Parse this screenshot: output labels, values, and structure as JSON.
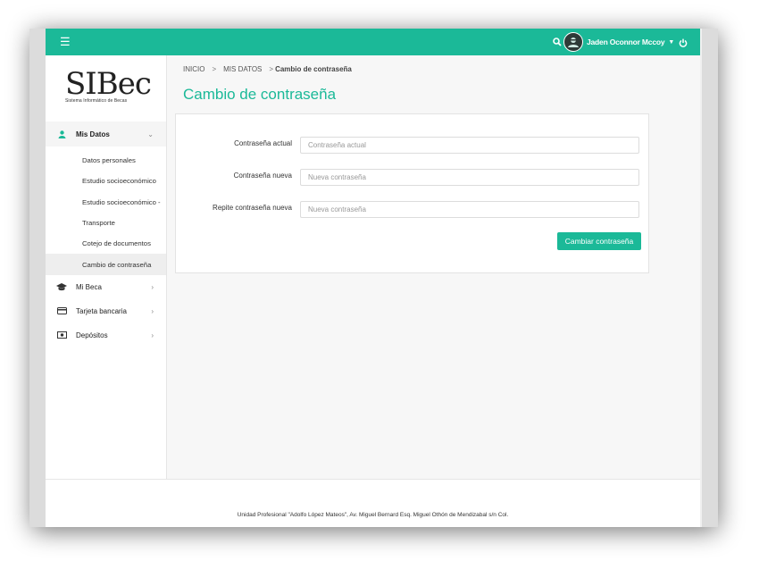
{
  "topbar": {
    "menu_icon": "hamburger-icon",
    "search_icon": "search-icon",
    "user_name": "Jaden Oconnor Mccoy",
    "caret_icon": "chevron-down-icon",
    "power_icon": "power-icon",
    "accent_color": "#1bb998"
  },
  "logo": {
    "text": "SIBec",
    "subtitle": "Sistema Informático de Becas"
  },
  "sidebar": {
    "groups": [
      {
        "label": "Mis Datos",
        "icon": "user-icon",
        "expanded": true,
        "items": [
          {
            "label": "Datos personales"
          },
          {
            "label": "Estudio socioeconómico"
          },
          {
            "label": "Estudio socioeconómico -"
          },
          {
            "label": "Transporte"
          },
          {
            "label": "Cotejo de documentos"
          },
          {
            "label": "Cambio de contraseña",
            "active": true
          }
        ]
      },
      {
        "label": "Mi Beca",
        "icon": "graduation-cap-icon"
      },
      {
        "label": "Tarjeta bancaria",
        "icon": "credit-card-icon"
      },
      {
        "label": "Depósitos",
        "icon": "money-icon"
      }
    ]
  },
  "breadcrumb": {
    "items": [
      "INICIO",
      "MIS DATOS"
    ],
    "current": "Cambio de contraseña"
  },
  "page": {
    "title": "Cambio de contraseña"
  },
  "form": {
    "fields": [
      {
        "label": "Contraseña actual",
        "placeholder": "Contraseña actual",
        "value": ""
      },
      {
        "label": "Contraseña nueva",
        "placeholder": "Nueva contraseña",
        "value": ""
      },
      {
        "label": "Repite contraseña nueva",
        "placeholder": "Nueva contraseña",
        "value": ""
      }
    ],
    "submit_label": "Cambiar contraseña"
  },
  "footer": {
    "text": "Unidad Profesional \"Adolfo López Mateos\", Av. Miguel Bernard Esq. Miguel Othón de Mendizabal s/n Col."
  }
}
